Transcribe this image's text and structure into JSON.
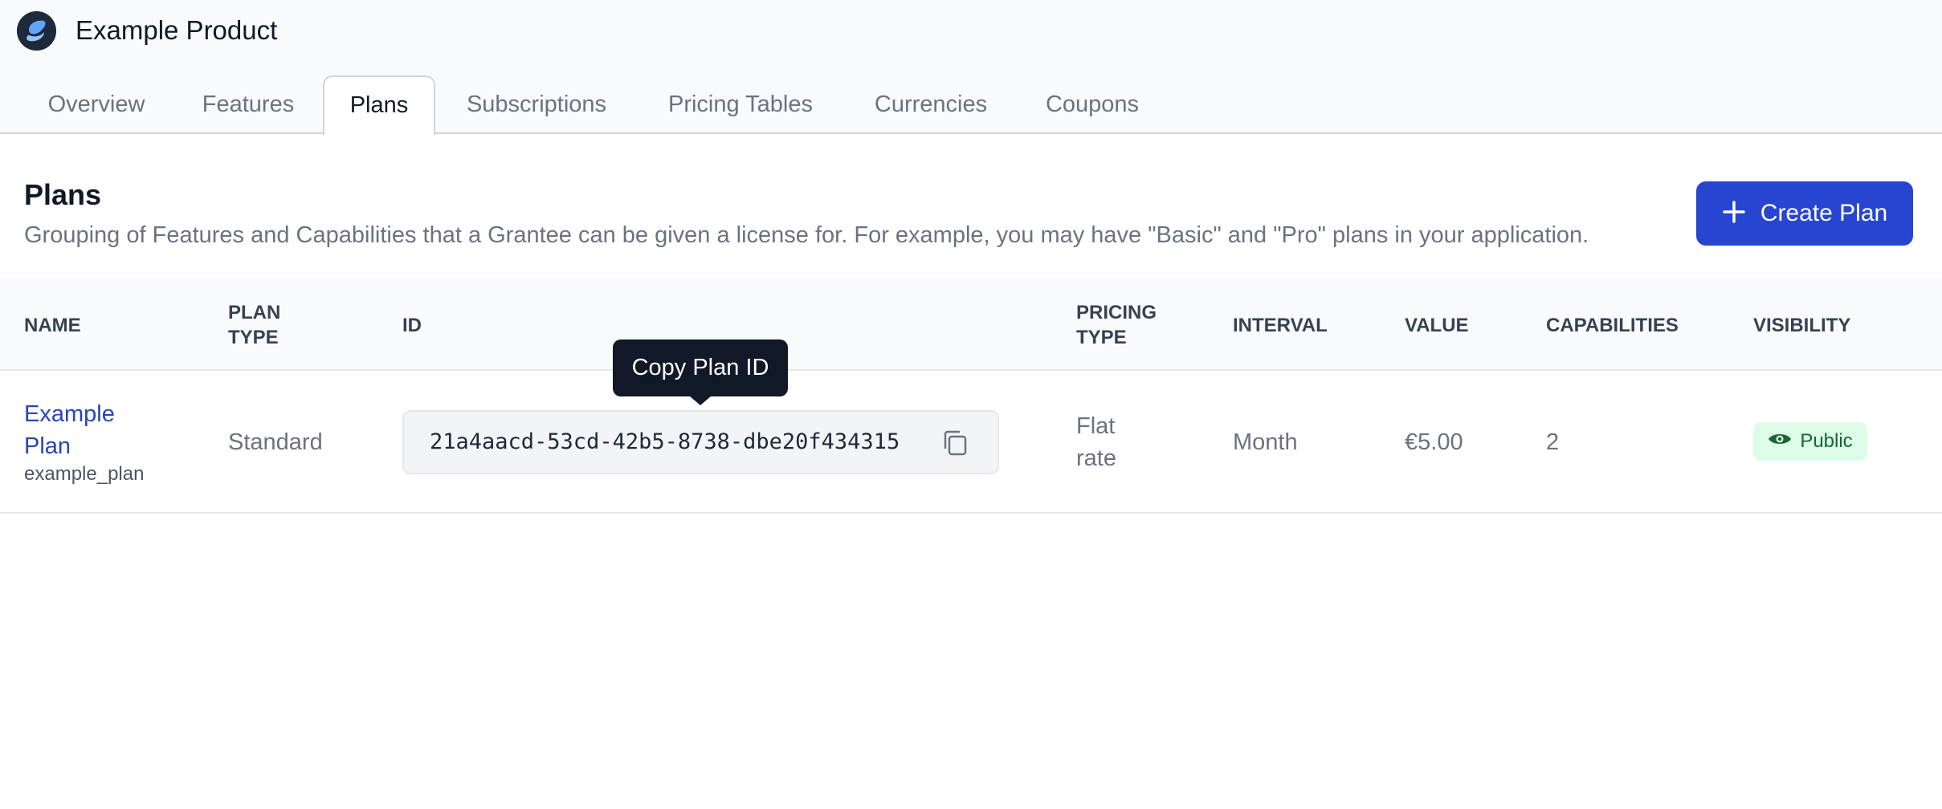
{
  "app": {
    "title": "Example Product"
  },
  "tabs": [
    {
      "label": "Overview"
    },
    {
      "label": "Features"
    },
    {
      "label": "Plans",
      "active": true
    },
    {
      "label": "Subscriptions"
    },
    {
      "label": "Pricing Tables"
    },
    {
      "label": "Currencies"
    },
    {
      "label": "Coupons"
    }
  ],
  "section": {
    "title": "Plans",
    "description": "Grouping of Features and Capabilities that a Grantee can be given a license for. For example, you may have \"Basic\" and \"Pro\" plans in your application.",
    "create_label": "Create Plan"
  },
  "table": {
    "headers": {
      "name": "NAME",
      "plan_type_1": "PLAN",
      "plan_type_2": "TYPE",
      "id": "ID",
      "pricing_type_1": "PRICING",
      "pricing_type_2": "TYPE",
      "interval": "INTERVAL",
      "value": "VALUE",
      "capabilities": "CAPABILITIES",
      "visibility": "VISIBILITY"
    },
    "rows": [
      {
        "name_1": "Example",
        "name_2": "Plan",
        "slug": "example_plan",
        "plan_type": "Standard",
        "id": "21a4aacd-53cd-42b5-8738-dbe20f434315",
        "pricing_type_1": "Flat",
        "pricing_type_2": "rate",
        "interval": "Month",
        "value": "€5.00",
        "capabilities": "2",
        "visibility": "Public"
      }
    ]
  },
  "tooltip": {
    "text": "Copy Plan ID"
  },
  "icons": {
    "logo": "product-logo-icon",
    "plus": "plus-icon",
    "copy": "copy-icon",
    "eye": "eye-icon"
  },
  "colors": {
    "accent": "#2845d1",
    "link": "#2845b8",
    "badge_bg": "#dcfce7",
    "badge_text": "#166534",
    "tooltip_bg": "#111827"
  }
}
